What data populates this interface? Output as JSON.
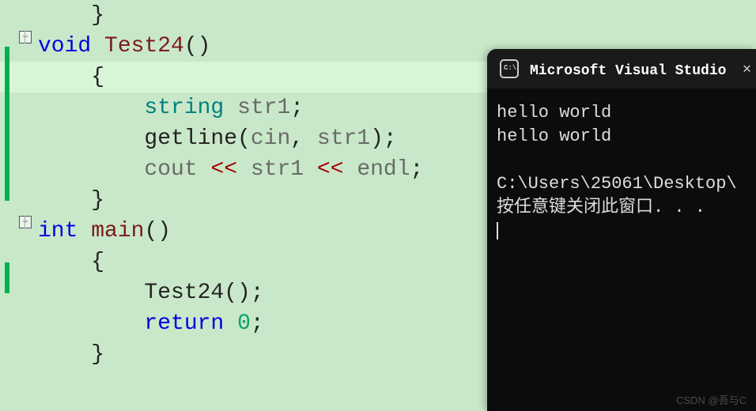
{
  "editor": {
    "lines": [
      {
        "indent": 1,
        "tokens": [
          {
            "t": "}",
            "c": "punc"
          }
        ],
        "change": false
      },
      {
        "indent": 0,
        "tokens": [
          {
            "t": "void",
            "c": "kw"
          },
          {
            "t": " ",
            "c": ""
          },
          {
            "t": "Test24",
            "c": "fn"
          },
          {
            "t": "()",
            "c": "punc"
          }
        ],
        "change": false,
        "fold": true
      },
      {
        "indent": 1,
        "tokens": [
          {
            "t": "{",
            "c": "punc"
          }
        ],
        "change": true,
        "hl": true
      },
      {
        "indent": 2,
        "tokens": [
          {
            "t": "string",
            "c": "type-id"
          },
          {
            "t": " ",
            "c": ""
          },
          {
            "t": "str1",
            "c": "var"
          },
          {
            "t": ";",
            "c": "punc"
          }
        ],
        "change": true
      },
      {
        "indent": 2,
        "tokens": [
          {
            "t": "getline",
            "c": "gfn"
          },
          {
            "t": "(",
            "c": "punc"
          },
          {
            "t": "cin",
            "c": "var"
          },
          {
            "t": ", ",
            "c": "punc"
          },
          {
            "t": "str1",
            "c": "var"
          },
          {
            "t": ")",
            "c": "punc"
          },
          {
            "t": ";",
            "c": "punc"
          }
        ],
        "change": true
      },
      {
        "indent": 2,
        "tokens": [
          {
            "t": "cout",
            "c": "var"
          },
          {
            "t": " ",
            "c": ""
          },
          {
            "t": "<<",
            "c": "op"
          },
          {
            "t": " ",
            "c": ""
          },
          {
            "t": "str1",
            "c": "var"
          },
          {
            "t": " ",
            "c": ""
          },
          {
            "t": "<<",
            "c": "op"
          },
          {
            "t": " ",
            "c": ""
          },
          {
            "t": "endl",
            "c": "var"
          },
          {
            "t": ";",
            "c": "punc"
          }
        ],
        "change": true
      },
      {
        "indent": 1,
        "tokens": [
          {
            "t": "}",
            "c": "punc"
          }
        ],
        "change": true
      },
      {
        "indent": 0,
        "tokens": [
          {
            "t": "int",
            "c": "kw"
          },
          {
            "t": " ",
            "c": ""
          },
          {
            "t": "main",
            "c": "fn"
          },
          {
            "t": "()",
            "c": "punc"
          }
        ],
        "change": false,
        "fold": true
      },
      {
        "indent": 1,
        "tokens": [
          {
            "t": "{",
            "c": "punc"
          }
        ],
        "change": false
      },
      {
        "indent": 2,
        "tokens": [
          {
            "t": "Test24",
            "c": "gfn"
          },
          {
            "t": "()",
            "c": "punc"
          },
          {
            "t": ";",
            "c": "punc"
          }
        ],
        "change": true
      },
      {
        "indent": 2,
        "tokens": [
          {
            "t": "return",
            "c": "kw"
          },
          {
            "t": " ",
            "c": ""
          },
          {
            "t": "0",
            "c": "num"
          },
          {
            "t": ";",
            "c": "punc"
          }
        ],
        "change": false
      },
      {
        "indent": 1,
        "tokens": [
          {
            "t": "}",
            "c": "punc"
          }
        ],
        "change": false
      }
    ],
    "fold_glyph": "−"
  },
  "terminal": {
    "title": "Microsoft Visual Studio 调试",
    "lines": [
      "hello world",
      "hello world",
      "",
      "C:\\Users\\25061\\Desktop\\",
      "按任意键关闭此窗口. . ."
    ]
  },
  "watermark": "CSDN @吾与C"
}
